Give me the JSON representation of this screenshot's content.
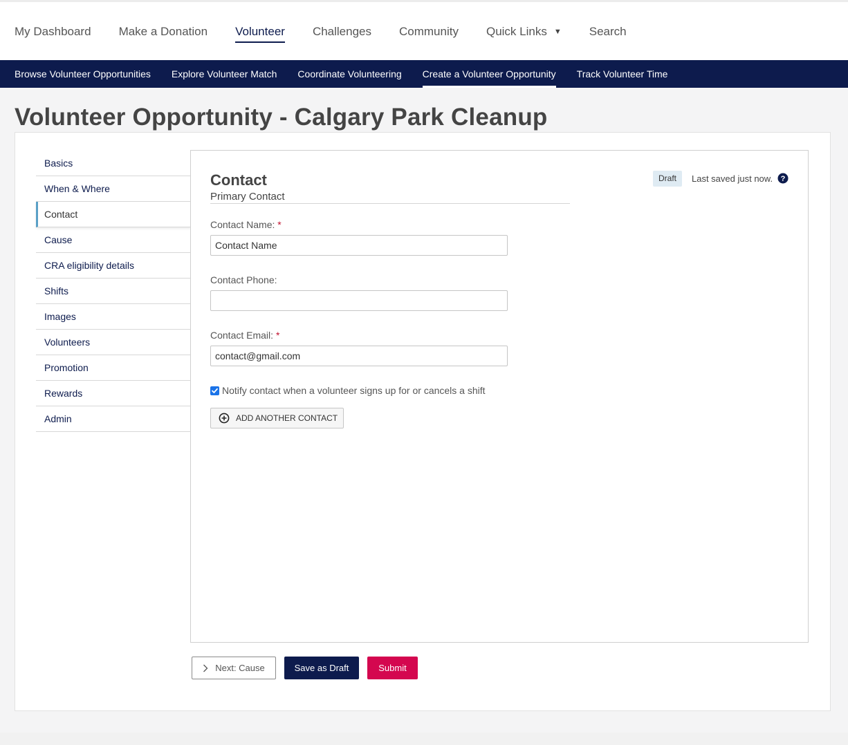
{
  "top_nav": {
    "items": [
      "My Dashboard",
      "Make a Donation",
      "Volunteer",
      "Challenges",
      "Community",
      "Quick Links",
      "Search"
    ],
    "active": "Volunteer"
  },
  "sub_nav": {
    "items": [
      "Browse Volunteer Opportunities",
      "Explore Volunteer Match",
      "Coordinate Volunteering",
      "Create a Volunteer Opportunity",
      "Track Volunteer Time"
    ],
    "active": "Create a Volunteer Opportunity"
  },
  "page": {
    "title": "Volunteer Opportunity - Calgary Park Cleanup"
  },
  "sidebar": {
    "tabs": [
      "Basics",
      "When & Where",
      "Contact",
      "Cause",
      "CRA eligibility details",
      "Shifts",
      "Images",
      "Volunteers",
      "Promotion",
      "Rewards",
      "Admin"
    ],
    "active": "Contact"
  },
  "section": {
    "title": "Contact",
    "subtitle": "Primary Contact",
    "badge": "Draft",
    "saved_status": "Last saved just now."
  },
  "form": {
    "name_label": "Contact Name:",
    "name_value": "Contact Name",
    "phone_label": "Contact Phone:",
    "phone_value": "",
    "email_label": "Contact Email:",
    "email_value": "contact@gmail.com",
    "required_mark": "*",
    "notify_label": "Notify contact when a volunteer signs up for or cancels a shift",
    "notify_checked": true,
    "add_contact_label": "ADD ANOTHER CONTACT"
  },
  "actions": {
    "next_label": "Next: Cause",
    "save_draft_label": "Save as Draft",
    "submit_label": "Submit"
  },
  "colors": {
    "brand_navy": "#0d1b4d",
    "submit_pink": "#d4074f",
    "active_tab_accent": "#5aa0c6",
    "required_red": "#c0102e"
  },
  "icons": {
    "quick_links_caret": "caret-down-icon",
    "help": "question-circle-icon",
    "add_contact": "plus-circle-icon",
    "next": "chevron-right-icon",
    "checkbox": "check-icon"
  }
}
